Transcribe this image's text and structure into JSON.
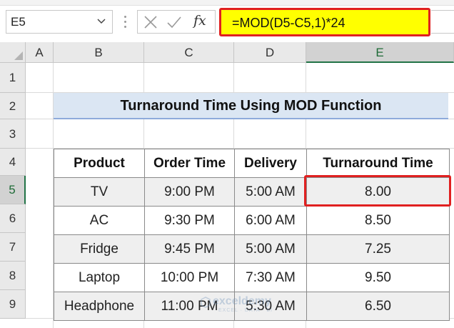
{
  "name_box": {
    "value": "E5"
  },
  "formula_bar": {
    "formula": "=MOD(D5-C5,1)*24"
  },
  "columns": [
    "A",
    "B",
    "C",
    "D",
    "E"
  ],
  "rows": [
    "1",
    "2",
    "3",
    "4",
    "5",
    "6",
    "7",
    "8",
    "9"
  ],
  "selected": {
    "column": "E",
    "row": "5"
  },
  "title": "Turnaround Time Using MOD Function",
  "table": {
    "headers": [
      "Product",
      "Order Time",
      "Delivery",
      "Turnaround Time"
    ],
    "rows": [
      [
        "TV",
        "9:00 PM",
        "5:00 AM",
        "8.00"
      ],
      [
        "AC",
        "9:30 PM",
        "6:00 AM",
        "8.50"
      ],
      [
        "Fridge",
        "9:45 PM",
        "5:00 AM",
        "7.25"
      ],
      [
        "Laptop",
        "10:00 PM",
        "7:30 AM",
        "9.50"
      ],
      [
        "Headphone",
        "11:00 PM",
        "5:30 AM",
        "6.50"
      ]
    ]
  },
  "watermark": {
    "name": "exceldemy",
    "tagline": "EXCEL · DATA · BI"
  },
  "colors": {
    "highlight_yellow": "#ffff00",
    "highlight_red": "#e02020",
    "title_fill": "#dbe6f3",
    "selection_green": "#217346"
  }
}
